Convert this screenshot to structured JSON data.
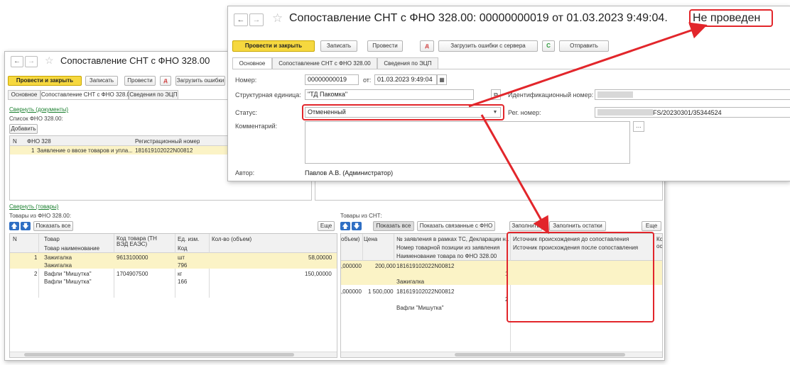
{
  "back_window": {
    "title": "Сопоставление СНТ с ФНО 328.00",
    "toolbar": {
      "post_close": "Провести и закрыть",
      "save": "Записать",
      "post": "Провести",
      "load_errors": "Загрузить ошибки"
    },
    "tabs": [
      "Основное",
      "Сопоставление СНТ с ФНО 328.00",
      "Сведения по ЭЦП"
    ],
    "collapse_docs": "Свернуть (документы)",
    "fno_list_label": "Список ФНО 328.00:",
    "add_button": "Добавить",
    "fno_table": {
      "headers": [
        "N",
        "ФНО 328",
        "Регистрационный номер"
      ],
      "rows": [
        {
          "n": "1",
          "name": "Заявление о ввозе товаров и упла...",
          "reg": "181619102022N00812"
        }
      ]
    },
    "collapse_goods": "Свернуть (товары)",
    "goods_fno_label": "Товары из ФНО 328.00:",
    "show_all": "Показать все",
    "more": "Еще",
    "goods_table": {
      "headers": [
        "N",
        "Товар",
        "Код товара (ТН ВЭД ЕАЭС)",
        "Ед. изм.",
        "Кол-во (объем)"
      ],
      "subheaders": [
        "Товар наименование",
        "Код"
      ],
      "rows": [
        {
          "n": "1",
          "name": "Зажигалка",
          "code": "9613100000",
          "unit": "шт",
          "qty": "58,00000",
          "subname": "Зажигалка",
          "subcode": "796"
        },
        {
          "n": "2",
          "name": "Вафли \"Мишутка\"",
          "code": "1704907500",
          "unit": "кг",
          "qty": "150,00000",
          "subname": "Вафли \"Мишутка\"",
          "subcode": "166"
        }
      ]
    },
    "snt_label": "Товары из СНТ:",
    "show_all2": "Показать все",
    "show_linked": "Показать связанные с ФНО",
    "fill": "Заполнить",
    "fill_rest": "Заполнить остатки",
    "more2": "Еще",
    "snt_table": {
      "headers": [
        "объем)",
        "Цена",
        "№ заявления в рамках ТС, Декларации н...",
        "Источник происхождения до сопоставления",
        "Ко"
      ],
      "headers2": [
        "Номер товарной позиции из заявления",
        "Источник происхождения после сопоставления",
        "ос"
      ],
      "headers3": [
        "Наименование товара по ФНО 328.00"
      ],
      "rows": [
        {
          "qty": ",000000",
          "price": "200,000",
          "app": "181619102022N00812",
          "pos": "1",
          "name": "Зажигалка"
        },
        {
          "qty": ",000000",
          "price": "1 500,000",
          "app": "181619102022N00812",
          "pos": "2",
          "name": "Вафли \"Мишутка\""
        }
      ]
    }
  },
  "front_window": {
    "title": "Сопоставление СНТ с ФНО 328.00: 00000000019 от 01.03.2023 9:49:04.",
    "status_text": "Не проведен",
    "toolbar": {
      "post_close": "Провести и закрыть",
      "save": "Записать",
      "post": "Провести",
      "load_errors": "Загрузить ошибки с сервера",
      "send": "Отправить"
    },
    "tabs": [
      "Основное",
      "Сопоставление СНТ с ФНО 328.00",
      "Сведения по ЭЦП"
    ],
    "form": {
      "number_label": "Номер:",
      "number_value": "00000000019",
      "from_label": "от:",
      "date_value": "01.03.2023  9:49:04",
      "unit_label": "Структурная единица:",
      "unit_value": "\"ТД Пакомка\"",
      "id_label": "Идентификационный номер:",
      "status_label": "Статус:",
      "status_value": "Отмененный",
      "reg_label": "Рег. номер:",
      "reg_value": "FS/20230301/35344524",
      "comment_label": "Комментарий:",
      "author_label": "Автор:",
      "author_value": "Павлов А.В. (Администратор)"
    }
  },
  "colors": {
    "highlight": "#e2262b",
    "primary": "#f6d83f",
    "link": "#1a7f2e",
    "selected_row": "#fbf3c6"
  }
}
